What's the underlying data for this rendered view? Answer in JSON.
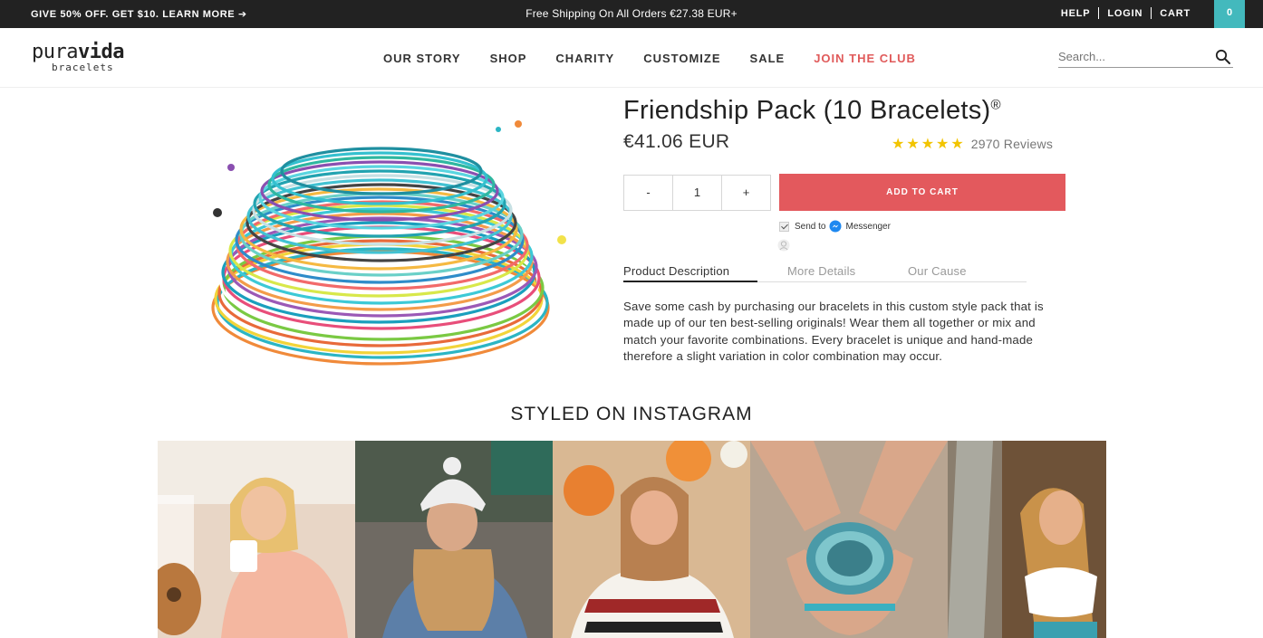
{
  "topbar": {
    "promo": "GIVE 50% OFF. GET $10. LEARN MORE",
    "promo_arrow": "➔",
    "shipping": "Free Shipping On All Orders  €27.38 EUR+",
    "help": "HELP",
    "login": "LOGIN",
    "cart": "CART",
    "cart_count": "0",
    "cart_color": "#43b9bd"
  },
  "header": {
    "logo_top_a": "pura",
    "logo_top_b": "vida",
    "logo_bottom": "bracelets",
    "nav": {
      "our_story": "OUR STORY",
      "shop": "SHOP",
      "charity": "CHARITY",
      "customize": "CUSTOMIZE",
      "sale": "SALE",
      "join_club": "JOIN THE CLUB"
    },
    "search_placeholder": "Search..."
  },
  "product": {
    "title": "Friendship Pack (10 Bracelets)",
    "title_mark": "®",
    "price": "€41.06 EUR",
    "stars": "★★★★★",
    "reviews": "2970 Reviews",
    "qty_minus": "-",
    "qty_value": "1",
    "qty_plus": "+",
    "add_to_cart": "ADD TO CART",
    "add_to_cart_color": "#e3595d",
    "send_to": "Send to",
    "messenger": "Messenger",
    "tabs": {
      "description": "Product Description",
      "details": "More Details",
      "cause": "Our Cause"
    },
    "description": "Save some cash by purchasing our bracelets in this custom style pack that is made up of our ten best-selling originals! Wear them all together or mix and match your favorite combinations. Every bracelet is unique and hand-made therefore a slight variation in color combination may occur."
  },
  "instagram": {
    "title": "STYLED ON INSTAGRAM"
  }
}
